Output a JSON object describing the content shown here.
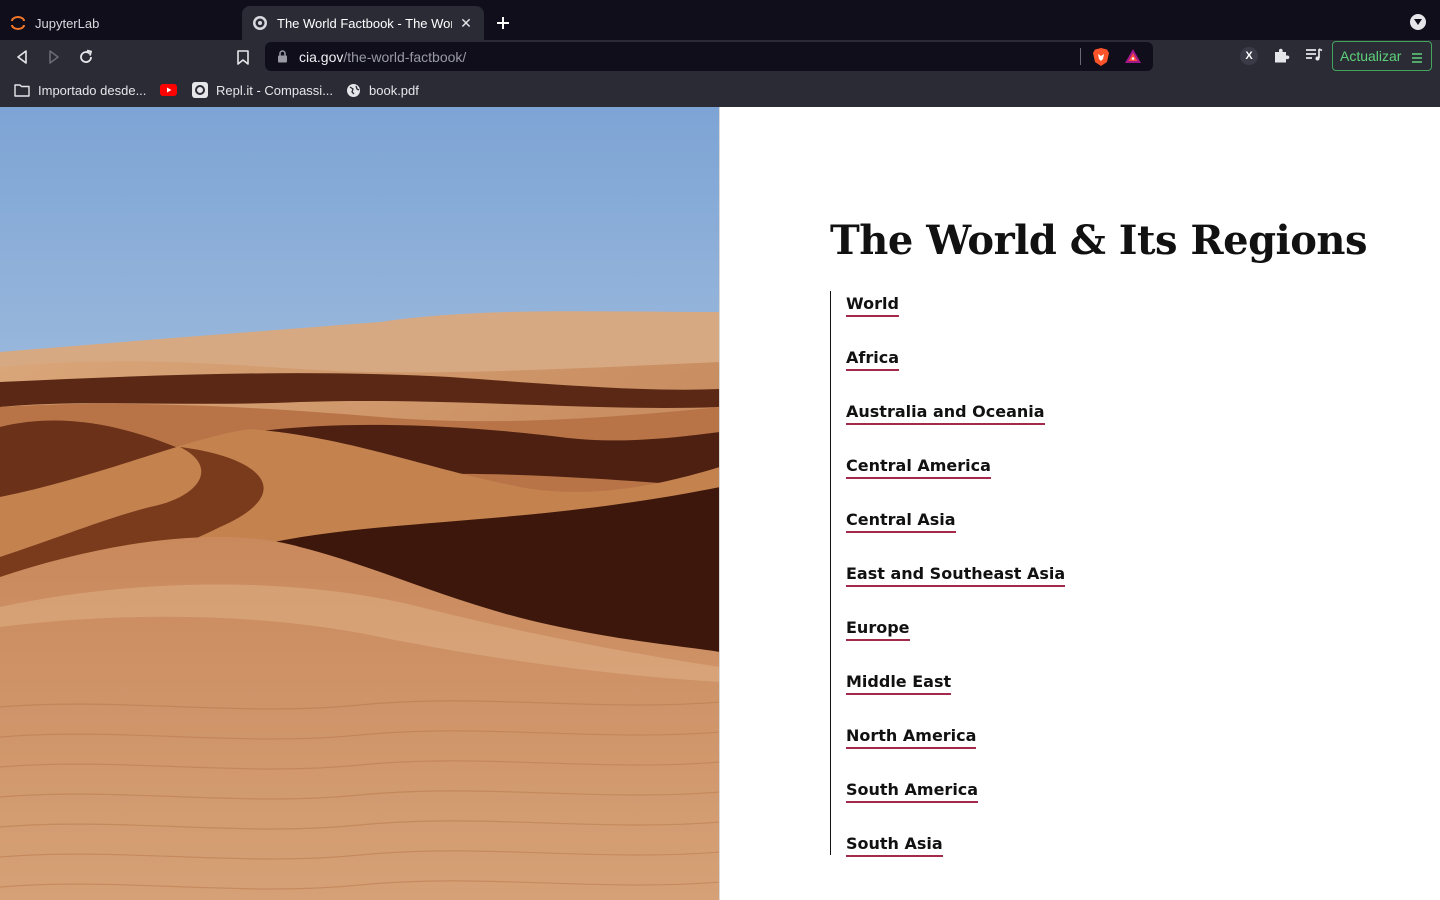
{
  "browser": {
    "tabs": [
      {
        "label": "JupyterLab",
        "active": false
      },
      {
        "label": "The World Factbook - The World",
        "active": true
      }
    ],
    "url_host": "cia.gov",
    "url_path": "/the-world-factbook/",
    "update_button_label": "Actualizar",
    "extension_x_label": "X",
    "bookmarks": [
      {
        "label": "Importado desde..."
      },
      {
        "label": ""
      },
      {
        "label": "Repl.it - Compassi..."
      },
      {
        "label": "book.pdf"
      }
    ]
  },
  "page": {
    "title": "The World & Its Regions",
    "regions": [
      "World",
      "Africa",
      "Australia and Oceania",
      "Central America",
      "Central Asia",
      "East and Southeast Asia",
      "Europe",
      "Middle East",
      "North America",
      "South America",
      "South Asia"
    ]
  },
  "colors": {
    "accent_underline": "#a32a4a",
    "update_button": "#5ed17a",
    "chrome_dark": "#0f0e1a",
    "chrome_toolbar": "#2b2b36"
  }
}
